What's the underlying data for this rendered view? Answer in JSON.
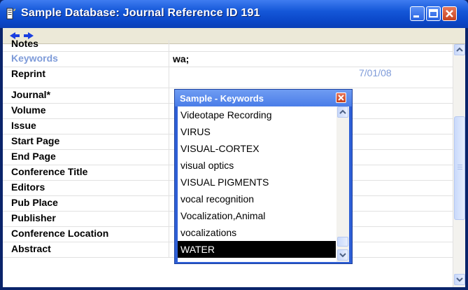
{
  "window": {
    "title": "Sample Database: Journal Reference ID 191",
    "icon": "document-icon",
    "buttons": [
      "minimize-icon",
      "maximize-icon",
      "close-icon"
    ]
  },
  "navbar": {
    "back_icon": "arrow-left-icon",
    "forward_icon": "arrow-right-icon"
  },
  "fields": [
    {
      "label": "Notes",
      "value": ""
    },
    {
      "label": "Keywords",
      "value": "wa;"
    },
    {
      "label": "Reprint",
      "value": "",
      "date_fragment": "7/01/08"
    },
    {
      "label": "Journal*",
      "value": ""
    },
    {
      "label": "Volume",
      "value": ""
    },
    {
      "label": "Issue",
      "value": ""
    },
    {
      "label": "Start Page",
      "value": ""
    },
    {
      "label": "End Page",
      "value": ""
    },
    {
      "label": "Conference Title",
      "value": ""
    },
    {
      "label": "Editors",
      "value": ""
    },
    {
      "label": "Pub Place",
      "value": ""
    },
    {
      "label": "Publisher",
      "value": ""
    },
    {
      "label": "Conference Location",
      "value": ""
    },
    {
      "label": "Abstract",
      "value": ""
    }
  ],
  "keywords_popup": {
    "title": "Sample - Keywords",
    "items": [
      "Videotape Recording",
      "VIRUS",
      "VISUAL-CORTEX",
      "visual optics",
      "VISUAL PIGMENTS",
      "vocal recognition",
      "Vocalization,Animal",
      "vocalizations",
      "WATER"
    ],
    "selected": "WATER"
  },
  "colors": {
    "titlebar": "#1457d8",
    "highlight_label": "#7e9bd9",
    "selected_bg": "#000000"
  }
}
